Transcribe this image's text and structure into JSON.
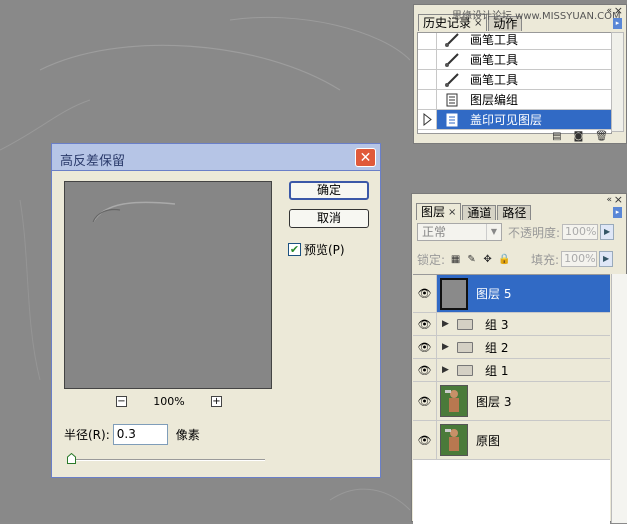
{
  "history_panel": {
    "tabs": [
      {
        "label": "历史记录",
        "close": "×"
      },
      {
        "label": "动作"
      }
    ],
    "watermark": "思缘设计论坛 www.MISSYUAN.COM",
    "items": [
      {
        "label": "画笔工具",
        "icon": "brush-icon"
      },
      {
        "label": "画笔工具",
        "icon": "brush-icon"
      },
      {
        "label": "画笔工具",
        "icon": "brush-icon"
      },
      {
        "label": "图层编组",
        "icon": "history-doc-icon"
      },
      {
        "label": "盖印可见图层",
        "icon": "history-doc-icon",
        "selected": true
      }
    ]
  },
  "layers_panel": {
    "tabs": [
      {
        "label": "图层",
        "close": "×"
      },
      {
        "label": "通道"
      },
      {
        "label": "路径"
      }
    ],
    "blend_mode": "正常",
    "opacity_label": "不透明度:",
    "opacity_value": "100%",
    "lock_label": "锁定:",
    "fill_label": "填充:",
    "fill_value": "100%",
    "layers": [
      {
        "name": "图层 5",
        "type": "layer",
        "selected": true
      },
      {
        "name": "组 3",
        "type": "group"
      },
      {
        "name": "组 2",
        "type": "group"
      },
      {
        "name": "组 1",
        "type": "group"
      },
      {
        "name": "图层 3",
        "type": "photo"
      },
      {
        "name": "原图",
        "type": "photo"
      }
    ]
  },
  "dialog": {
    "title": "高反差保留",
    "ok_label": "确定",
    "cancel_label": "取消",
    "preview_label": "预览(P)",
    "preview_checked": true,
    "zoom_level": "100%",
    "zoom_out": "−",
    "zoom_in": "+",
    "radius_label": "半径(R):",
    "radius_value": "0.3",
    "radius_unit": "像素",
    "radius_slider_fraction": 0.0
  }
}
